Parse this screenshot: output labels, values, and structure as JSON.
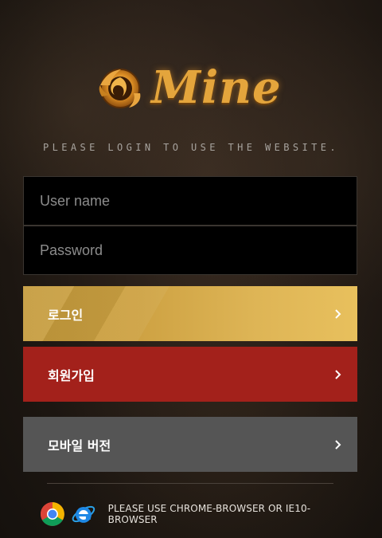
{
  "logo": {
    "text": "Mine"
  },
  "tagline": "PLEASE LOGIN TO USE THE WEBSITE.",
  "form": {
    "username_placeholder": "User name",
    "password_placeholder": "Password"
  },
  "buttons": {
    "login": "로그인",
    "join": "회원가입",
    "mobile": "모바일 버전"
  },
  "colors": {
    "login_gold": "#deb556",
    "join_red": "#a3211b",
    "mobile_gray": "#555555"
  },
  "icons": {
    "logo_emblem": "flame-emblem-icon",
    "chevron": "chevron-right-icon",
    "chrome": "chrome-icon",
    "ie": "internet-explorer-icon"
  },
  "footer": {
    "browser_note": "PLEASE USE CHROME-BROWSER OR IE10-BROWSER"
  }
}
